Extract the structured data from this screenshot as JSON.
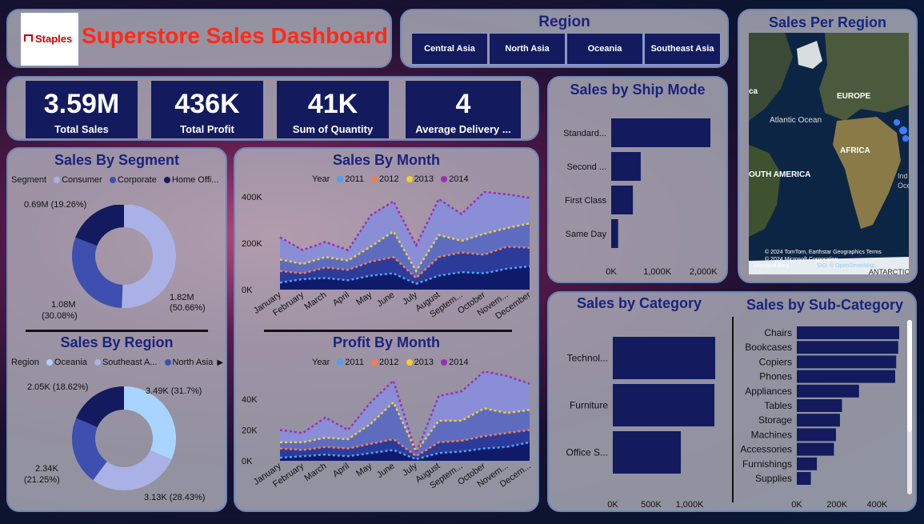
{
  "header": {
    "logo_text": "Staples",
    "title": "Superstore Sales Dashboard"
  },
  "region_slicer": {
    "title": "Region",
    "options": [
      "Central Asia",
      "North Asia",
      "Oceania",
      "Southeast Asia"
    ]
  },
  "map": {
    "title": "Sales Per Region",
    "labels": [
      "EUROPE",
      "Atlantic Ocean",
      "AFRICA",
      "OUTH AMERICA",
      "ANTARCTIC",
      "ca",
      "Ind",
      "Oce"
    ],
    "credits": [
      "© 2024 TomTom, Earthstar Geographics  Terms",
      "© 2024 Microsoft Corporation",
      "SIO, © OpenStreetMap"
    ],
    "bing": "Microsoft Bing"
  },
  "kpis": [
    {
      "value": "3.59M",
      "label": "Total Sales"
    },
    {
      "value": "436K",
      "label": "Total Profit"
    },
    {
      "value": "41K",
      "label": "Sum of Quantity"
    },
    {
      "value": "4",
      "label": "Average Delivery ..."
    }
  ],
  "segment": {
    "title": "Sales By Segment",
    "legend_title": "Segment",
    "legend": [
      {
        "name": "Consumer",
        "color": "#aab1e6"
      },
      {
        "name": "Corporate",
        "color": "#3f4fb0"
      },
      {
        "name": "Home Offi...",
        "color": "#131b5e"
      }
    ],
    "labels": [
      "0.69M (19.26%)",
      "1.82M",
      "(50.66%)",
      "1.08M",
      "(30.08%)"
    ]
  },
  "region_chart": {
    "title": "Sales By Region",
    "legend_title": "Region",
    "legend": [
      {
        "name": "Oceania",
        "color": "#a8d4ff"
      },
      {
        "name": "Southeast A...",
        "color": "#aab1e6"
      },
      {
        "name": "North Asia",
        "color": "#3f4fb0"
      }
    ],
    "labels": [
      "2.05K (18.62%)",
      "3.49K (31.7%)",
      "2.34K",
      "(21.25%)",
      "3.13K (28.43%)"
    ]
  },
  "month_legend": {
    "title": "Year",
    "items": [
      {
        "name": "2011",
        "color": "#4aa3f0"
      },
      {
        "name": "2012",
        "color": "#f08050"
      },
      {
        "name": "2013",
        "color": "#f0d030"
      },
      {
        "name": "2014",
        "color": "#9b30b0"
      }
    ]
  },
  "sales_month_title": "Sales By Month",
  "profit_month_title": "Profit By Month",
  "ship_mode": {
    "title": "Sales by Ship Mode",
    "ticks": [
      "0K",
      "1,000K",
      "2,000K"
    ]
  },
  "category": {
    "title": "Sales by Category",
    "ticks": [
      "0K",
      "500K",
      "1,000K"
    ]
  },
  "subcategory": {
    "title": "Sales by Sub-Category",
    "ticks": [
      "0K",
      "200K",
      "400K"
    ]
  },
  "chart_data": [
    {
      "type": "pie",
      "title": "Sales By Segment",
      "categories": [
        "Consumer",
        "Corporate",
        "Home Office"
      ],
      "values": [
        1.82,
        1.08,
        0.69
      ],
      "colors": [
        "#aab1e6",
        "#3f4fb0",
        "#131b5e"
      ]
    },
    {
      "type": "pie",
      "title": "Sales By Region",
      "categories": [
        "Oceania",
        "Southeast Asia",
        "North Asia",
        "Central Asia"
      ],
      "values": [
        3.49,
        3.13,
        2.34,
        2.05
      ],
      "colors": [
        "#a8d4ff",
        "#aab1e6",
        "#3f4fb0",
        "#131b5e"
      ]
    },
    {
      "type": "area",
      "title": "Sales By Month",
      "categories": [
        "January",
        "February",
        "March",
        "April",
        "May",
        "June",
        "July",
        "August",
        "Septem...",
        "October",
        "Novem...",
        "December"
      ],
      "yticks": [
        "0K",
        "200K",
        "400K"
      ],
      "ylim": [
        0,
        420000
      ],
      "series": [
        {
          "name": "2011",
          "values": [
            30000,
            45000,
            50000,
            40000,
            60000,
            70000,
            25000,
            60000,
            75000,
            70000,
            90000,
            100000
          ]
        },
        {
          "name": "2012",
          "values": [
            80000,
            70000,
            95000,
            85000,
            120000,
            140000,
            50000,
            140000,
            160000,
            150000,
            185000,
            180000
          ]
        },
        {
          "name": "2013",
          "values": [
            130000,
            110000,
            140000,
            125000,
            185000,
            250000,
            80000,
            235000,
            210000,
            240000,
            265000,
            285000
          ]
        },
        {
          "name": "2014",
          "values": [
            225000,
            170000,
            205000,
            170000,
            320000,
            380000,
            190000,
            390000,
            325000,
            420000,
            410000,
            395000
          ]
        }
      ]
    },
    {
      "type": "area",
      "title": "Profit By Month",
      "categories": [
        "January",
        "February",
        "March",
        "April",
        "May",
        "June",
        "July",
        "August",
        "Septem...",
        "October",
        "Novem...",
        "Decem..."
      ],
      "yticks": [
        "0K",
        "20K",
        "40K"
      ],
      "ylim": [
        0,
        55000
      ],
      "series": [
        {
          "name": "2011",
          "values": [
            2000,
            3000,
            4000,
            3000,
            5000,
            7000,
            1000,
            5000,
            6000,
            8000,
            9000,
            12000
          ]
        },
        {
          "name": "2012",
          "values": [
            8000,
            7000,
            9000,
            8000,
            11000,
            14000,
            3000,
            12000,
            13000,
            16000,
            18000,
            20000
          ]
        },
        {
          "name": "2013",
          "values": [
            12000,
            12000,
            15000,
            14000,
            24000,
            38000,
            6000,
            26000,
            26000,
            34000,
            31000,
            33000
          ]
        },
        {
          "name": "2014",
          "values": [
            20000,
            18000,
            28000,
            20000,
            38000,
            52000,
            5000,
            42000,
            45000,
            58000,
            55000,
            50000
          ]
        }
      ]
    },
    {
      "type": "bar",
      "title": "Sales by Ship Mode",
      "categories": [
        "Standard...",
        "Second ...",
        "First Class",
        "Same Day"
      ],
      "values": [
        2150000,
        640000,
        470000,
        150000
      ],
      "xlim": [
        0,
        2150000
      ]
    },
    {
      "type": "bar",
      "title": "Sales by Category",
      "categories": [
        "Technol...",
        "Furniture",
        "Office S..."
      ],
      "values": [
        1310000,
        1300000,
        870000
      ],
      "xlim": [
        0,
        1310000
      ]
    },
    {
      "type": "bar",
      "title": "Sales by Sub-Category",
      "categories": [
        "Chairs",
        "Bookcases",
        "Copiers",
        "Phones",
        "Appliances",
        "Tables",
        "Storage",
        "Machines",
        "Accessories",
        "Furnishings",
        "Supplies"
      ],
      "values": [
        510000,
        505000,
        495000,
        490000,
        310000,
        225000,
        215000,
        195000,
        185000,
        100000,
        70000
      ],
      "xlim": [
        0,
        510000
      ]
    }
  ]
}
